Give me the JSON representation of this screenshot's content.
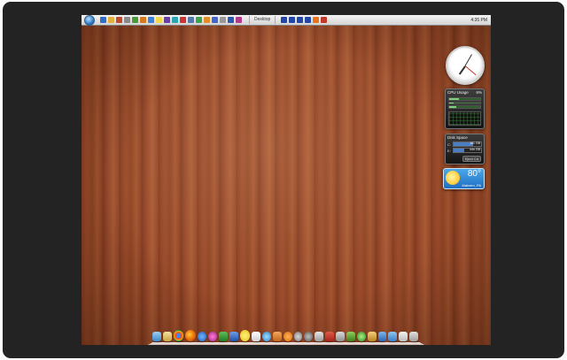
{
  "taskbar": {
    "start_icon": "windows-orb-icon",
    "quick_launch_icons": [
      "app-icon-1",
      "app-icon-2",
      "app-icon-3",
      "app-icon-4",
      "app-icon-5",
      "app-icon-6",
      "app-icon-7",
      "app-icon-8",
      "app-icon-9",
      "app-icon-10",
      "app-icon-11",
      "app-icon-12",
      "app-icon-13",
      "app-icon-14",
      "app-icon-15",
      "app-icon-16",
      "app-icon-17",
      "app-icon-18",
      "app-icon-19",
      "app-icon-20",
      "app-icon-21",
      "app-icon-22",
      "app-icon-23",
      "app-icon-24"
    ],
    "desktop_label": "Desktop",
    "time": "4:35 PM"
  },
  "gadgets": {
    "cpu": {
      "title": "CPU Usage",
      "percent": "6%"
    },
    "disk": {
      "title": "Disk Space",
      "drives": [
        {
          "letter": "C:",
          "size": "161 GB",
          "used_fraction": 0.7
        },
        {
          "letter": "E:",
          "size": "min GB",
          "used_fraction": 0.4
        }
      ],
      "eject_label": "Eject Cd"
    },
    "weather": {
      "temperature": "80°",
      "location": "Malvern, PA"
    }
  },
  "colors": {
    "wood": "#924627",
    "frame": "#232323",
    "taskbar": "#e2e2e2"
  }
}
